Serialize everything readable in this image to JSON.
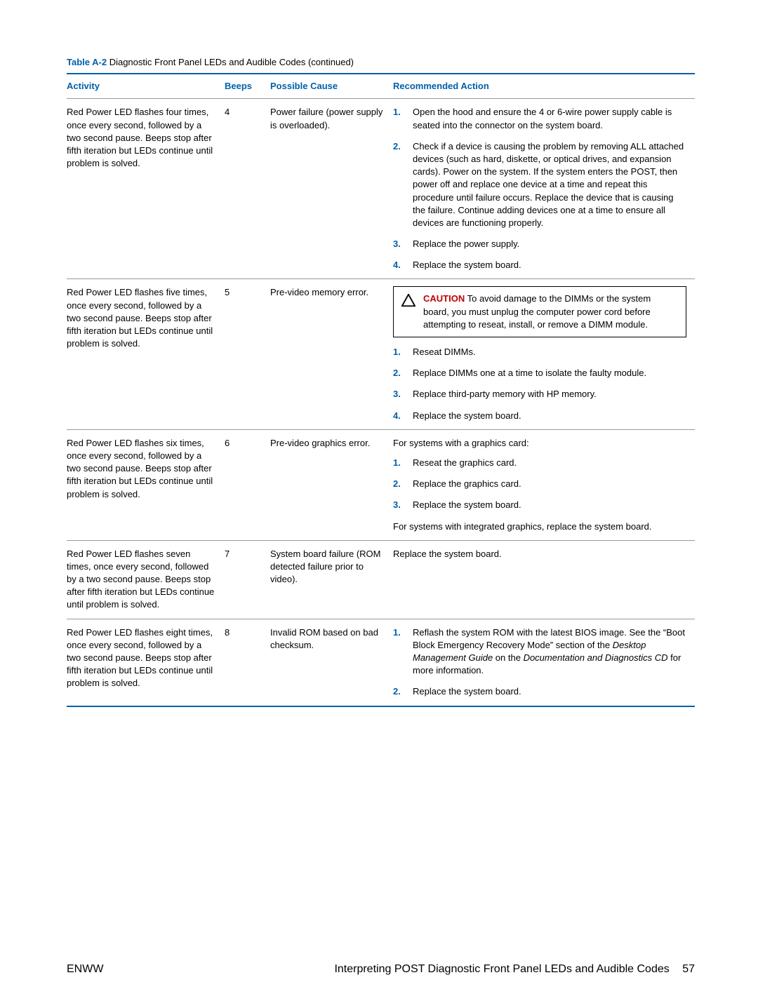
{
  "table_caption_prefix": "Table A-2",
  "table_caption_rest": "  Diagnostic Front Panel LEDs and Audible Codes (continued)",
  "headers": {
    "activity": "Activity",
    "beeps": "Beeps",
    "cause": "Possible Cause",
    "action": "Recommended Action"
  },
  "rows": [
    {
      "activity": "Red Power LED flashes four times, once every second, followed by a two second pause. Beeps stop after fifth iteration but LEDs continue until problem is solved.",
      "beeps": "4",
      "cause": "Power failure (power supply is overloaded).",
      "actions_type": "list",
      "actions": [
        "Open the hood and ensure the 4 or 6-wire power supply cable is seated into the connector on the system board.",
        "Check if a device is causing the problem by removing ALL attached devices (such as hard, diskette, or optical drives, and expansion cards). Power on the system. If the system enters the POST, then power off and replace one device at a time and repeat this procedure until failure occurs. Replace the device that is causing the failure. Continue adding devices one at a time to ensure all devices are functioning properly.",
        "Replace the power supply.",
        "Replace the system board."
      ]
    },
    {
      "activity": "Red Power LED flashes five times, once every second, followed by a two second pause. Beeps stop after fifth iteration but LEDs continue until problem is solved.",
      "beeps": "5",
      "cause": "Pre-video memory error.",
      "actions_type": "caution_list",
      "caution_label": "CAUTION",
      "caution_text": "To avoid damage to the DIMMs or the system board, you must unplug the computer power cord before attempting to reseat, install, or remove a DIMM module.",
      "actions": [
        "Reseat DIMMs.",
        "Replace DIMMs one at a time to isolate the faulty module.",
        "Replace third-party memory with HP memory.",
        "Replace the system board."
      ]
    },
    {
      "activity": "Red Power LED flashes six times, once every second, followed by a two second pause. Beeps stop after fifth iteration but LEDs continue until problem is solved.",
      "beeps": "6",
      "cause": "Pre-video graphics error.",
      "actions_type": "pre_post_list",
      "pre_text": "For systems with a graphics card:",
      "actions": [
        "Reseat the graphics card.",
        "Replace the graphics card.",
        "Replace the system board."
      ],
      "post_text": "For systems with integrated graphics, replace the system board."
    },
    {
      "activity": "Red Power LED flashes seven times, once every second, followed by a two second pause. Beeps stop after fifth iteration but LEDs continue until problem is solved.",
      "beeps": "7",
      "cause": "System board failure (ROM detected failure prior to video).",
      "actions_type": "plain",
      "plain": "Replace the system board."
    },
    {
      "activity": "Red Power LED flashes eight times, once every second, followed by a two second pause. Beeps stop after fifth iteration but LEDs continue until problem is solved.",
      "beeps": "8",
      "cause": "Invalid ROM based on bad checksum.",
      "actions_type": "list_rich",
      "actions_rich": [
        {
          "pre": "Reflash the system ROM with the latest BIOS image. See the “Boot Block Emergency Recovery Mode” section of the ",
          "ital": "Desktop Management Guide",
          "mid": " on the ",
          "ital2": "Documentation and Diagnostics CD",
          "post": " for more information."
        },
        {
          "plain": "Replace the system board."
        }
      ]
    }
  ],
  "footer": {
    "left": "ENWW",
    "right_title": "Interpreting POST Diagnostic Front Panel LEDs and Audible Codes",
    "page": "57"
  }
}
